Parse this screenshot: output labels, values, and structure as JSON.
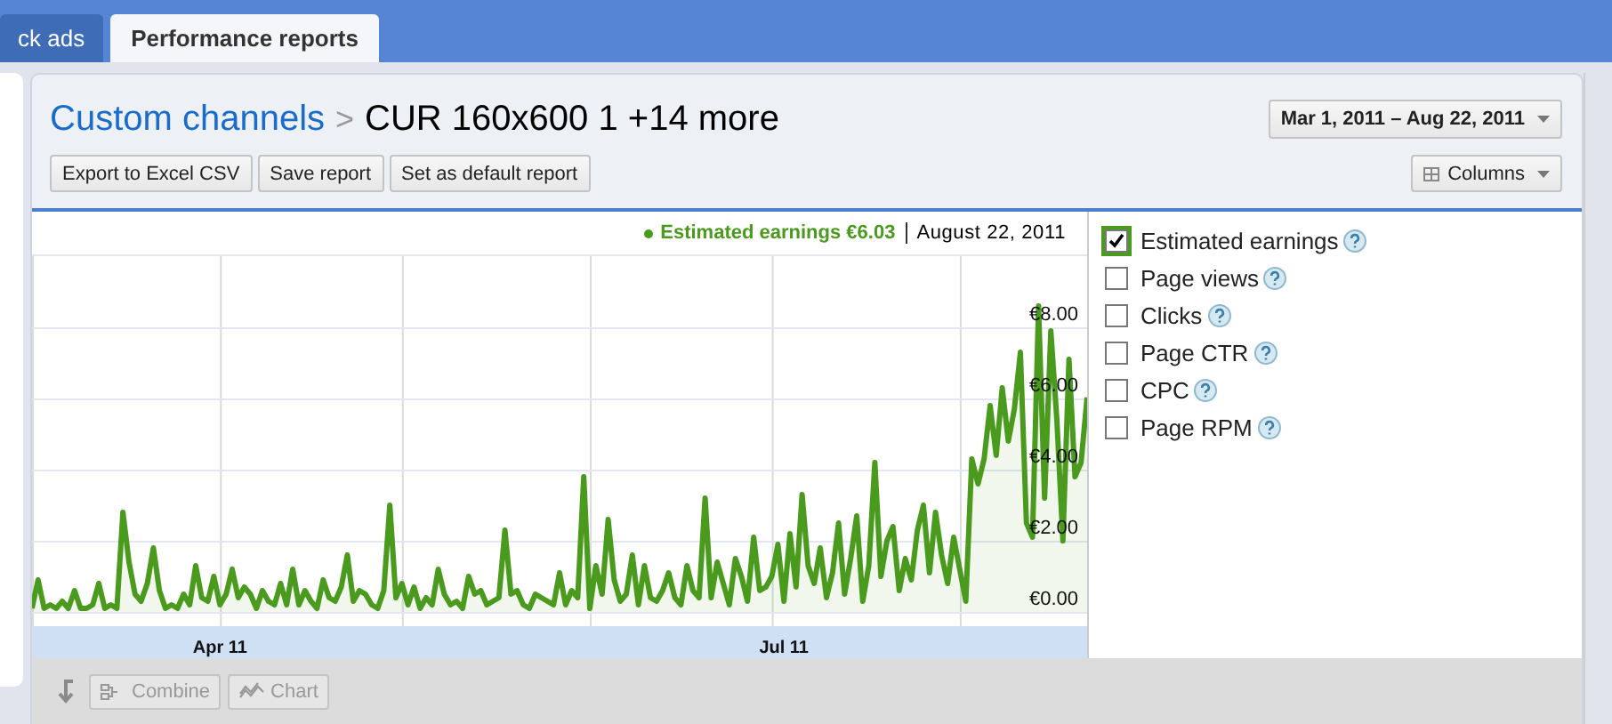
{
  "tabs": [
    {
      "label": "ck ads",
      "selected": false
    },
    {
      "label": "Performance reports",
      "selected": true
    }
  ],
  "report": {
    "breadcrumb": {
      "parent": "Custom channels",
      "separator": ">",
      "current": "CUR 160x600 1 +14 more"
    },
    "date_range": "Mar 1, 2011 – Aug 22, 2011",
    "actions": [
      "Export to Excel CSV",
      "Save report",
      "Set as default report"
    ],
    "columns_button": "Columns"
  },
  "chart": {
    "legend": {
      "value": "€6.03",
      "date": "August 22, 2011"
    },
    "chart_data": {
      "type": "area",
      "grid": true,
      "categories": [
        null,
        null,
        null,
        null,
        null,
        null,
        null,
        null,
        null,
        null,
        null,
        null,
        null,
        null,
        null,
        null,
        null,
        null,
        null,
        null,
        null,
        null,
        null,
        null,
        null,
        null,
        null,
        null,
        null,
        null,
        null,
        "Apr 11",
        null,
        null,
        null,
        null,
        null,
        null,
        null,
        null,
        null,
        null,
        null,
        null,
        null,
        null,
        null,
        null,
        null,
        null,
        null,
        null,
        null,
        null,
        null,
        null,
        null,
        null,
        null,
        null,
        null,
        null,
        null,
        null,
        null,
        null,
        null,
        null,
        null,
        null,
        null,
        null,
        null,
        null,
        null,
        null,
        null,
        null,
        null,
        null,
        null,
        null,
        null,
        null,
        null,
        null,
        null,
        null,
        null,
        null,
        null,
        null,
        null,
        null,
        null,
        null,
        null,
        null,
        null,
        null,
        null,
        null,
        null,
        null,
        null,
        null,
        null,
        null,
        null,
        null,
        null,
        null,
        null,
        null,
        null,
        null,
        null,
        null,
        null,
        null,
        null,
        null,
        null,
        null,
        "Jul 11",
        null,
        null,
        null,
        null,
        null,
        null,
        null,
        null,
        null,
        null,
        null,
        null,
        null,
        null,
        null,
        null,
        null,
        null,
        null,
        null,
        null,
        null,
        null,
        null,
        null,
        null,
        null,
        null,
        null,
        null,
        null,
        null,
        null,
        null,
        null,
        null,
        null,
        null,
        null,
        null,
        null,
        null,
        null,
        null,
        null,
        null,
        null,
        null,
        null,
        null
      ],
      "ylim": [
        -0.4,
        10
      ],
      "yticks": [
        {
          "value": 0,
          "label": "€0.00"
        },
        {
          "value": 2,
          "label": "€2.00"
        },
        {
          "value": 4,
          "label": "€4.00"
        },
        {
          "value": 6,
          "label": "€6.00"
        },
        {
          "value": 8,
          "label": "€8.00"
        }
      ],
      "series": [
        {
          "name": "Estimated earnings",
          "color": "#4a9a1e",
          "values": [
            0.1,
            0.9,
            0.1,
            0.2,
            0.1,
            0.3,
            0.1,
            0.6,
            0.1,
            0.1,
            0.2,
            0.8,
            0.1,
            0.2,
            0.1,
            2.8,
            1.4,
            0.5,
            0.3,
            0.8,
            1.8,
            0.6,
            0.1,
            0.2,
            0.1,
            0.5,
            0.2,
            1.3,
            0.4,
            0.3,
            1.0,
            0.2,
            0.5,
            1.2,
            0.4,
            0.7,
            0.5,
            0.1,
            0.6,
            0.3,
            0.2,
            0.8,
            0.2,
            1.2,
            0.2,
            0.6,
            0.3,
            0.1,
            0.9,
            0.4,
            0.3,
            0.7,
            1.6,
            0.3,
            0.6,
            0.5,
            0.2,
            0.1,
            0.6,
            3.0,
            0.4,
            0.8,
            0.2,
            0.7,
            0.1,
            0.4,
            0.2,
            1.2,
            0.5,
            0.2,
            0.3,
            0.1,
            1.0,
            0.5,
            0.6,
            0.2,
            0.3,
            0.4,
            2.3,
            0.5,
            0.6,
            0.2,
            0.1,
            0.5,
            0.4,
            0.3,
            0.2,
            1.1,
            0.2,
            0.6,
            0.4,
            3.8,
            0.1,
            1.3,
            0.5,
            2.6,
            0.9,
            0.3,
            0.5,
            1.6,
            0.2,
            1.3,
            0.4,
            0.3,
            0.6,
            1.1,
            0.4,
            0.2,
            1.3,
            0.6,
            0.4,
            3.2,
            0.4,
            1.4,
            0.8,
            0.2,
            1.5,
            1.0,
            0.3,
            2.1,
            0.6,
            0.7,
            1.0,
            1.9,
            0.3,
            2.2,
            0.7,
            3.3,
            1.3,
            0.8,
            1.8,
            0.4,
            1.1,
            2.5,
            0.5,
            1.5,
            2.7,
            0.3,
            1.3,
            4.2,
            1.0,
            2.0,
            2.4,
            0.6,
            1.5,
            0.9,
            2.3,
            3.0,
            1.1,
            2.8,
            1.6,
            0.8,
            2.1,
            1.2,
            0.3,
            4.3,
            3.6,
            4.3,
            5.8,
            4.4,
            6.3,
            4.8,
            5.7,
            7.3,
            2.5,
            2.1,
            8.6,
            3.2,
            7.9,
            5.4,
            2.0,
            7.1,
            3.8,
            4.2,
            6.03
          ]
        }
      ]
    }
  },
  "metrics": [
    {
      "label": "Estimated earnings",
      "checked": true
    },
    {
      "label": "Page views",
      "checked": false
    },
    {
      "label": "Clicks",
      "checked": false
    },
    {
      "label": "Page CTR",
      "checked": false
    },
    {
      "label": "CPC",
      "checked": false
    },
    {
      "label": "Page RPM",
      "checked": false
    }
  ],
  "toolbar": [
    {
      "kind": "combine",
      "label": "Combine",
      "disabled": true
    },
    {
      "kind": "chart",
      "label": "Chart",
      "disabled": true
    }
  ]
}
